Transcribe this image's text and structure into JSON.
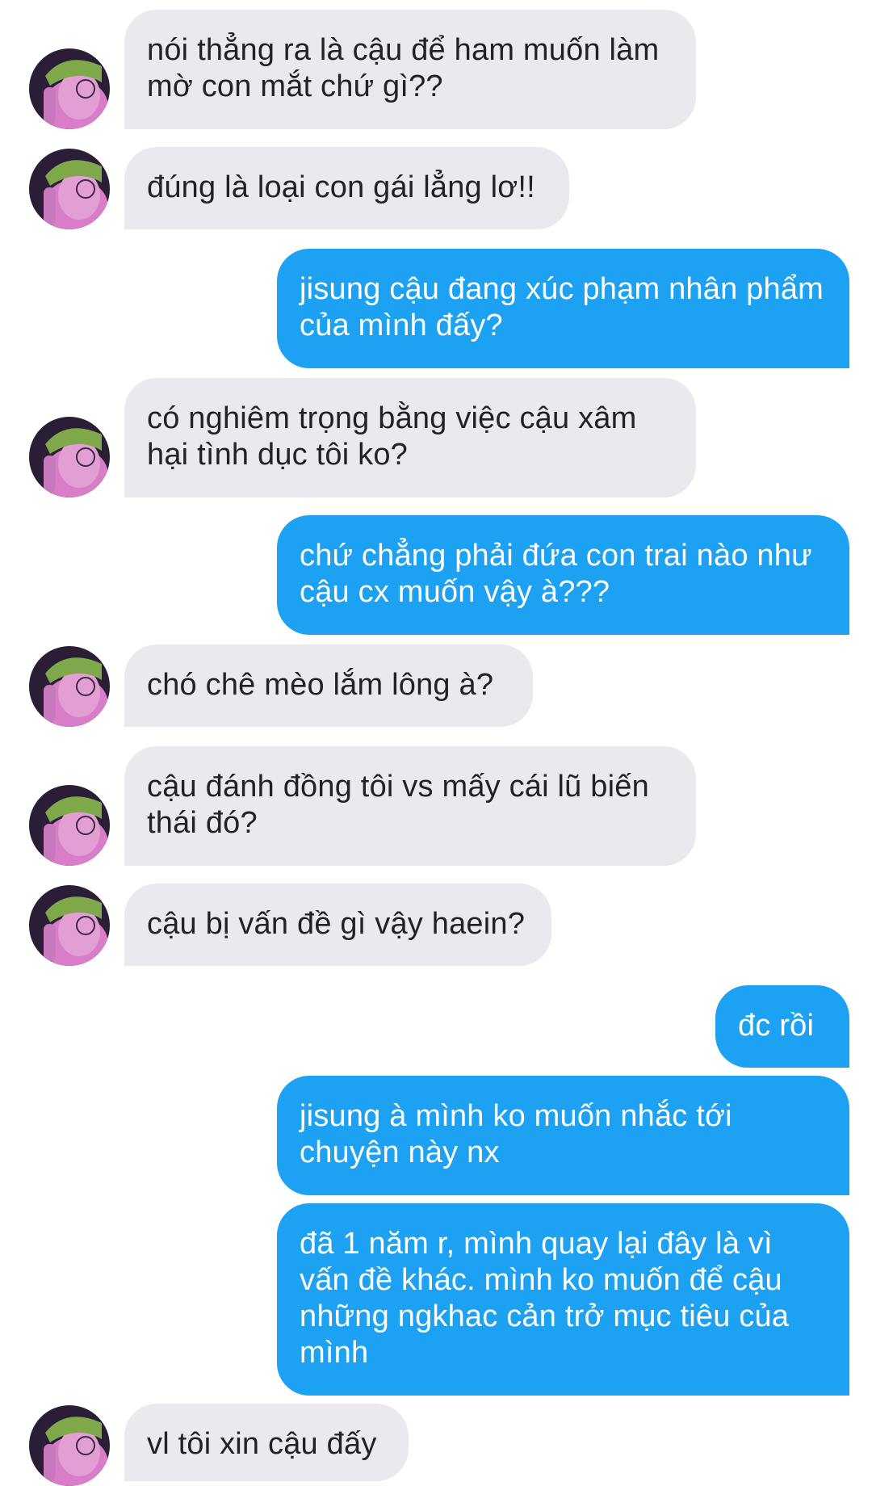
{
  "conversation": {
    "messages": [
      {
        "side": "in",
        "text": "nói thẳng ra là cậu để ham muốn làm mờ con mắt chứ gì??"
      },
      {
        "side": "in",
        "text": "đúng là loại con gái lẳng lơ!!"
      },
      {
        "side": "out",
        "text": "jisung cậu đang xúc phạm nhân phẩm của mình đấy?"
      },
      {
        "side": "in",
        "text": "có nghiêm trọng bằng việc cậu xâm hại tình dục tôi ko?"
      },
      {
        "side": "out",
        "text": "chứ chẳng phải đứa con trai nào như cậu cx muốn vậy à???"
      },
      {
        "side": "in",
        "text": "chó chê mèo lắm lông à?"
      },
      {
        "side": "in",
        "text": "cậu đánh đồng tôi vs mấy cái lũ biến thái đó?"
      },
      {
        "side": "in",
        "text": "cậu bị vấn đề gì vậy haein?"
      },
      {
        "side": "out",
        "text": "đc rồi"
      },
      {
        "side": "out",
        "text": "jisung à mình ko muốn nhắc tới chuyện này nx"
      },
      {
        "side": "out",
        "text": "đã 1 năm r, mình quay lại đây là vì vấn đề khác. mình ko muốn để cậu những ngkhac cản trở mục tiêu của mình"
      },
      {
        "side": "in",
        "text": "vl tôi xin cậu đấy"
      }
    ]
  },
  "colors": {
    "incoming_bubble": "#e8eaee",
    "incoming_text": "#1f2327",
    "outgoing_bubble": "#1da1f2",
    "outgoing_text": "#ffffff",
    "background": "#ffffff"
  },
  "icons": {
    "avatar": "contact-avatar-photo"
  }
}
